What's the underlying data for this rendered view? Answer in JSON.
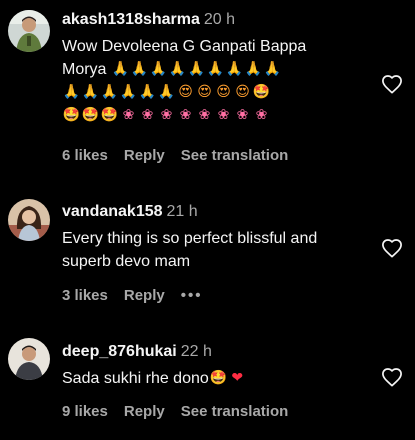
{
  "comments": [
    {
      "username": "akash1318sharma",
      "time": "20 h",
      "text_lines": [
        {
          "text": "Wow Devoleena G Ganpati Bappa",
          "emojis": []
        },
        {
          "text": "Morya",
          "emojis": [
            "pray",
            "pray",
            "pray",
            "pray",
            "pray",
            "pray",
            "pray",
            "pray",
            "pray"
          ]
        },
        {
          "text": "",
          "emojis": [
            "pray",
            "pray",
            "pray",
            "pray",
            "pray",
            "pray",
            "hearts",
            "hearts",
            "hearts",
            "hearts",
            "starface"
          ]
        },
        {
          "text": "",
          "emojis": [
            "starface",
            "starface",
            "starface",
            "flower",
            "flower",
            "flower",
            "flower",
            "flower",
            "flower",
            "flower",
            "flower"
          ]
        }
      ],
      "likes_label": "6 likes",
      "reply_label": "Reply",
      "translate_label": "See translation",
      "avatar_icon": "user-avatar-photo"
    },
    {
      "username": "vandanak158",
      "time": "21 h",
      "text_lines": [
        {
          "text": "Every thing is so perfect blissful and",
          "emojis": []
        },
        {
          "text": "superb devo mam",
          "emojis": []
        }
      ],
      "likes_label": "3 likes",
      "reply_label": "Reply",
      "more_label": "•••",
      "avatar_icon": "user-avatar-photo"
    },
    {
      "username": "deep_876hukai",
      "time": "22 h",
      "text_lines": [
        {
          "text": "Sada sukhi rhe dono",
          "emojis": [
            "starface",
            "heart"
          ]
        }
      ],
      "likes_label": "9 likes",
      "reply_label": "Reply",
      "translate_label": "See translation",
      "avatar_icon": "user-avatar-photo"
    }
  ],
  "emoji_glyphs": {
    "pray": "🙏",
    "hearts": "😍",
    "starface": "🤩",
    "flower": "❀",
    "heart": "❤"
  },
  "colors": {
    "background": "#000000",
    "primary_text": "#f5f5f5",
    "secondary_text": "#a8a8a8"
  },
  "icons": {
    "like": "heart-outline-icon"
  }
}
